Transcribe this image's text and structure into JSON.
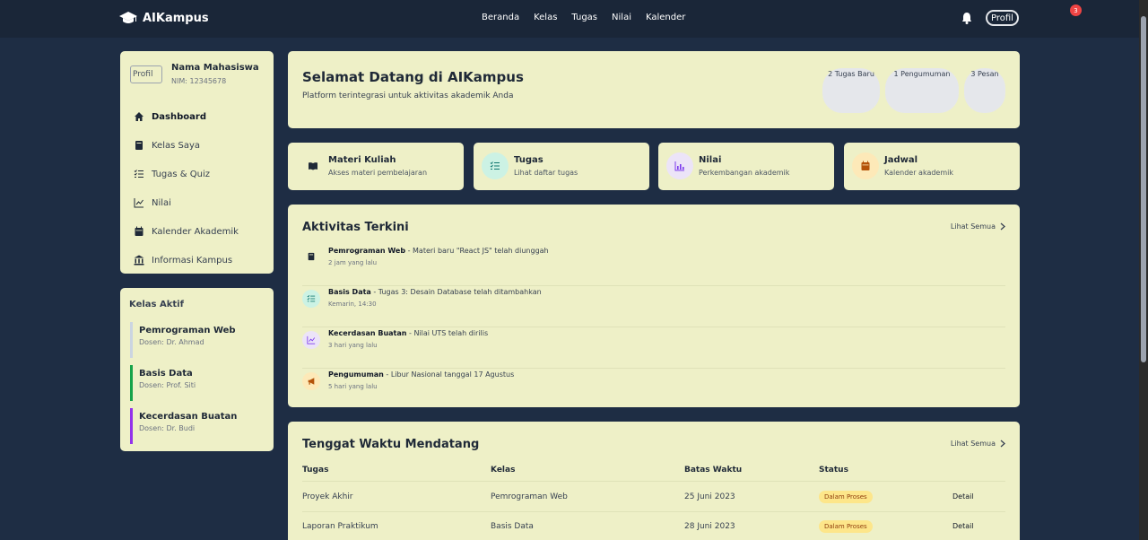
{
  "brand": {
    "name": "AIKampus"
  },
  "nav": [
    "Beranda",
    "Kelas",
    "Tugas",
    "Nilai",
    "Kalender"
  ],
  "topbar": {
    "avatar_alt": "Profil",
    "notification_count": "3"
  },
  "profile": {
    "avatar_alt": "Profil",
    "name": "Nama Mahasiswa",
    "nim": "NIM: 12345678"
  },
  "menu": [
    {
      "label": "Dashboard",
      "icon": "home-icon"
    },
    {
      "label": "Kelas Saya",
      "icon": "book-icon"
    },
    {
      "label": "Tugas & Quiz",
      "icon": "tasks-icon"
    },
    {
      "label": "Nilai",
      "icon": "chart-icon"
    },
    {
      "label": "Kalender Akademik",
      "icon": "calendar-icon"
    },
    {
      "label": "Informasi Kampus",
      "icon": "building-icon"
    }
  ],
  "active_classes": {
    "title": "Kelas Aktif",
    "items": [
      {
        "name": "Pemrograman Web",
        "lecturer": "Dosen: Dr. Ahmad",
        "color": "#cbd5e1"
      },
      {
        "name": "Basis Data",
        "lecturer": "Dosen: Prof. Siti",
        "color": "#16a34a"
      },
      {
        "name": "Kecerdasan Buatan",
        "lecturer": "Dosen: Dr. Budi",
        "color": "#9333ea"
      }
    ]
  },
  "welcome": {
    "title": "Selamat Datang di AIKampus",
    "subtitle": "Platform terintegrasi untuk aktivitas akademik Anda",
    "stats": [
      "2 Tugas Baru",
      "1 Pengumuman",
      "3 Pesan"
    ]
  },
  "quick_links": [
    {
      "title": "Materi Kuliah",
      "subtitle": "Akses materi pembelajaran",
      "icon": "book-open-icon",
      "bg": "#eef0c7"
    },
    {
      "title": "Tugas",
      "subtitle": "Lihat daftar tugas",
      "icon": "tasks-icon",
      "bg": "#ccf2e4"
    },
    {
      "title": "Nilai",
      "subtitle": "Perkembangan akademik",
      "icon": "chart-bar-icon",
      "bg": "#ece4f8"
    },
    {
      "title": "Jadwal",
      "subtitle": "Kalender akademik",
      "icon": "calendar-icon",
      "bg": "#fde9b8"
    }
  ],
  "activity": {
    "title": "Aktivitas Terkini",
    "see_all": "Lihat Semua",
    "items": [
      {
        "bold": "Pemrograman Web",
        "text": " - Materi baru \"React JS\" telah diunggah",
        "time": "2 jam yang lalu",
        "icon": "book-icon",
        "bg": "#eef0c7"
      },
      {
        "bold": "Basis Data",
        "text": " - Tugas 3: Desain Database telah ditambahkan",
        "time": "Kemarin, 14:30",
        "icon": "tasks-icon",
        "bg": "#ccf2e4"
      },
      {
        "bold": "Kecerdasan Buatan",
        "text": " - Nilai UTS telah dirilis",
        "time": "3 hari yang lalu",
        "icon": "chart-line-icon",
        "bg": "#ece4f8"
      },
      {
        "bold": "Pengumuman",
        "text": " - Libur Nasional tanggal 17 Agustus",
        "time": "5 hari yang lalu",
        "icon": "megaphone-icon",
        "bg": "#fde9b8"
      }
    ]
  },
  "deadlines": {
    "title": "Tenggat Waktu Mendatang",
    "see_all": "Lihat Semua",
    "headers": [
      "Tugas",
      "Kelas",
      "Batas Waktu",
      "Status"
    ],
    "rows": [
      {
        "task": "Proyek Akhir",
        "class": "Pemrograman Web",
        "due": "25 Juni 2023",
        "status": "Dalam Proses",
        "action": "Detail"
      },
      {
        "task": "Laporan Praktikum",
        "class": "Basis Data",
        "due": "28 Juni 2023",
        "status": "Dalam Proses",
        "action": "Detail"
      }
    ]
  }
}
